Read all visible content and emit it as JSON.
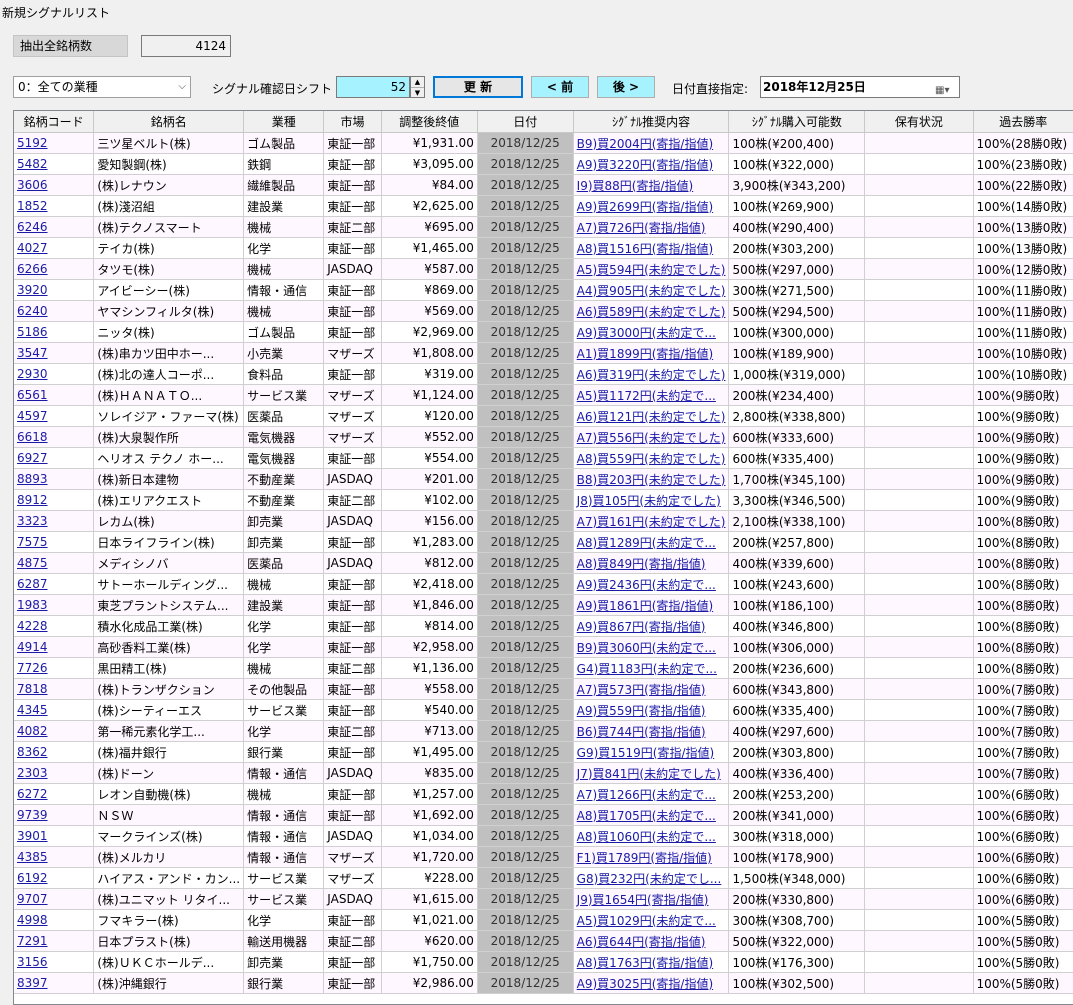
{
  "window": {
    "title": "新規シグナルリスト"
  },
  "summary": {
    "label": "抽出全銘柄数",
    "value": "4124"
  },
  "controls": {
    "industry_selected": "0：全ての業種",
    "shift_label": "シグナル確認日シフト",
    "shift_value": "52",
    "update_label": "更 新",
    "prev_label": "< 前",
    "next_label": "後 >",
    "date_label": "日付直接指定:",
    "date_value": "2018年12月25日"
  },
  "table": {
    "headers": [
      "銘柄コード",
      "銘柄名",
      "業種",
      "市場",
      "調整後終値",
      "日付",
      "ｼｸﾞﾅﾙ推奨内容",
      "ｼｸﾞﾅﾙ購入可能数",
      "保有状況",
      "過去勝率"
    ],
    "rows": [
      [
        "5192",
        "三ツ星ベルト(株)",
        "ゴム製品",
        "東証一部",
        "¥1,931.00",
        "2018/12/25",
        "B9)買2004円(寄指/指値)",
        "100株(¥200,400)",
        "",
        "100%(28勝0敗)"
      ],
      [
        "5482",
        "愛知製鋼(株)",
        "鉄鋼",
        "東証一部",
        "¥3,095.00",
        "2018/12/25",
        "A9)買3220円(寄指/指値)",
        "100株(¥322,000)",
        "",
        "100%(23勝0敗)"
      ],
      [
        "3606",
        "(株)レナウン",
        "繊維製品",
        "東証一部",
        "¥84.00",
        "2018/12/25",
        "I9)買88円(寄指/指値)",
        "3,900株(¥343,200)",
        "",
        "100%(22勝0敗)"
      ],
      [
        "1852",
        "(株)淺沼組",
        "建設業",
        "東証一部",
        "¥2,625.00",
        "2018/12/25",
        "A9)買2699円(寄指/指値)",
        "100株(¥269,900)",
        "",
        "100%(14勝0敗)"
      ],
      [
        "6246",
        "(株)テクノスマート",
        "機械",
        "東証二部",
        "¥695.00",
        "2018/12/25",
        "A7)買726円(寄指/指値)",
        "400株(¥290,400)",
        "",
        "100%(13勝0敗)"
      ],
      [
        "4027",
        "テイカ(株)",
        "化学",
        "東証一部",
        "¥1,465.00",
        "2018/12/25",
        "A8)買1516円(寄指/指値)",
        "200株(¥303,200)",
        "",
        "100%(13勝0敗)"
      ],
      [
        "6266",
        "タツモ(株)",
        "機械",
        "JASDAQ",
        "¥587.00",
        "2018/12/25",
        "A5)買594円(未約定でした)",
        "500株(¥297,000)",
        "",
        "100%(12勝0敗)"
      ],
      [
        "3920",
        "アイビーシー(株)",
        "情報・通信",
        "東証一部",
        "¥869.00",
        "2018/12/25",
        "A4)買905円(未約定でした)",
        "300株(¥271,500)",
        "",
        "100%(11勝0敗)"
      ],
      [
        "6240",
        "ヤマシンフィルタ(株)",
        "機械",
        "東証一部",
        "¥569.00",
        "2018/12/25",
        "A6)買589円(未約定でした)",
        "500株(¥294,500)",
        "",
        "100%(11勝0敗)"
      ],
      [
        "5186",
        "ニッタ(株)",
        "ゴム製品",
        "東証一部",
        "¥2,969.00",
        "2018/12/25",
        "A9)買3000円(未約定で...",
        "100株(¥300,000)",
        "",
        "100%(11勝0敗)"
      ],
      [
        "3547",
        "(株)串カツ田中ホー...",
        "小売業",
        "マザーズ",
        "¥1,808.00",
        "2018/12/25",
        "A1)買1899円(寄指/指値)",
        "100株(¥189,900)",
        "",
        "100%(10勝0敗)"
      ],
      [
        "2930",
        "(株)北の達人コーポ...",
        "食料品",
        "東証一部",
        "¥319.00",
        "2018/12/25",
        "A6)買319円(未約定でした)",
        "1,000株(¥319,000)",
        "",
        "100%(10勝0敗)"
      ],
      [
        "6561",
        "(株)ＨＡＮＡＴＯ...",
        "サービス業",
        "マザーズ",
        "¥1,124.00",
        "2018/12/25",
        "A5)買1172円(未約定で...",
        "200株(¥234,400)",
        "",
        "100%(9勝0敗)"
      ],
      [
        "4597",
        "ソレイジア・ファーマ(株)",
        "医薬品",
        "マザーズ",
        "¥120.00",
        "2018/12/25",
        "A6)買121円(未約定でした)",
        "2,800株(¥338,800)",
        "",
        "100%(9勝0敗)"
      ],
      [
        "6618",
        "(株)大泉製作所",
        "電気機器",
        "マザーズ",
        "¥552.00",
        "2018/12/25",
        "A7)買556円(未約定でした)",
        "600株(¥333,600)",
        "",
        "100%(9勝0敗)"
      ],
      [
        "6927",
        "ヘリオス テクノ ホー...",
        "電気機器",
        "東証一部",
        "¥554.00",
        "2018/12/25",
        "A8)買559円(未約定でした)",
        "600株(¥335,400)",
        "",
        "100%(9勝0敗)"
      ],
      [
        "8893",
        "(株)新日本建物",
        "不動産業",
        "JASDAQ",
        "¥201.00",
        "2018/12/25",
        "B8)買203円(未約定でした)",
        "1,700株(¥345,100)",
        "",
        "100%(9勝0敗)"
      ],
      [
        "8912",
        "(株)エリアクエスト",
        "不動産業",
        "東証二部",
        "¥102.00",
        "2018/12/25",
        "J8)買105円(未約定でした)",
        "3,300株(¥346,500)",
        "",
        "100%(9勝0敗)"
      ],
      [
        "3323",
        "レカム(株)",
        "卸売業",
        "JASDAQ",
        "¥156.00",
        "2018/12/25",
        "A7)買161円(未約定でした)",
        "2,100株(¥338,100)",
        "",
        "100%(8勝0敗)"
      ],
      [
        "7575",
        "日本ライフライン(株)",
        "卸売業",
        "東証一部",
        "¥1,283.00",
        "2018/12/25",
        "A8)買1289円(未約定で...",
        "200株(¥257,800)",
        "",
        "100%(8勝0敗)"
      ],
      [
        "4875",
        "メディシノバ",
        "医薬品",
        "JASDAQ",
        "¥812.00",
        "2018/12/25",
        "A8)買849円(寄指/指値)",
        "400株(¥339,600)",
        "",
        "100%(8勝0敗)"
      ],
      [
        "6287",
        "サトーホールディング...",
        "機械",
        "東証一部",
        "¥2,418.00",
        "2018/12/25",
        "A9)買2436円(未約定で...",
        "100株(¥243,600)",
        "",
        "100%(8勝0敗)"
      ],
      [
        "1983",
        "東芝プラントシステム...",
        "建設業",
        "東証一部",
        "¥1,846.00",
        "2018/12/25",
        "A9)買1861円(寄指/指値)",
        "100株(¥186,100)",
        "",
        "100%(8勝0敗)"
      ],
      [
        "4228",
        "積水化成品工業(株)",
        "化学",
        "東証一部",
        "¥814.00",
        "2018/12/25",
        "A9)買867円(寄指/指値)",
        "400株(¥346,800)",
        "",
        "100%(8勝0敗)"
      ],
      [
        "4914",
        "高砂香料工業(株)",
        "化学",
        "東証一部",
        "¥2,958.00",
        "2018/12/25",
        "B9)買3060円(未約定で...",
        "100株(¥306,000)",
        "",
        "100%(8勝0敗)"
      ],
      [
        "7726",
        "黒田精工(株)",
        "機械",
        "東証二部",
        "¥1,136.00",
        "2018/12/25",
        "G4)買1183円(未約定で...",
        "200株(¥236,600)",
        "",
        "100%(8勝0敗)"
      ],
      [
        "7818",
        "(株)トランザクション",
        "その他製品",
        "東証一部",
        "¥558.00",
        "2018/12/25",
        "A7)買573円(寄指/指値)",
        "600株(¥343,800)",
        "",
        "100%(7勝0敗)"
      ],
      [
        "4345",
        "(株)シーティーエス",
        "サービス業",
        "東証一部",
        "¥540.00",
        "2018/12/25",
        "A9)買559円(寄指/指値)",
        "600株(¥335,400)",
        "",
        "100%(7勝0敗)"
      ],
      [
        "4082",
        "第一稀元素化学工...",
        "化学",
        "東証二部",
        "¥713.00",
        "2018/12/25",
        "B6)買744円(寄指/指値)",
        "400株(¥297,600)",
        "",
        "100%(7勝0敗)"
      ],
      [
        "8362",
        "(株)福井銀行",
        "銀行業",
        "東証一部",
        "¥1,495.00",
        "2018/12/25",
        "G9)買1519円(寄指/指値)",
        "200株(¥303,800)",
        "",
        "100%(7勝0敗)"
      ],
      [
        "2303",
        "(株)ドーン",
        "情報・通信",
        "JASDAQ",
        "¥835.00",
        "2018/12/25",
        "J7)買841円(未約定でした)",
        "400株(¥336,400)",
        "",
        "100%(7勝0敗)"
      ],
      [
        "6272",
        "レオン自動機(株)",
        "機械",
        "東証一部",
        "¥1,257.00",
        "2018/12/25",
        "A7)買1266円(未約定で...",
        "200株(¥253,200)",
        "",
        "100%(6勝0敗)"
      ],
      [
        "9739",
        "ＮＳＷ",
        "情報・通信",
        "東証一部",
        "¥1,692.00",
        "2018/12/25",
        "A8)買1705円(未約定で...",
        "200株(¥341,000)",
        "",
        "100%(6勝0敗)"
      ],
      [
        "3901",
        "マークラインズ(株)",
        "情報・通信",
        "JASDAQ",
        "¥1,034.00",
        "2018/12/25",
        "A8)買1060円(未約定で...",
        "300株(¥318,000)",
        "",
        "100%(6勝0敗)"
      ],
      [
        "4385",
        "(株)メルカリ",
        "情報・通信",
        "マザーズ",
        "¥1,720.00",
        "2018/12/25",
        "F1)買1789円(寄指/指値)",
        "100株(¥178,900)",
        "",
        "100%(6勝0敗)"
      ],
      [
        "6192",
        "ハイアス・アンド・カン...",
        "サービス業",
        "マザーズ",
        "¥228.00",
        "2018/12/25",
        "G8)買232円(未約定でし...",
        "1,500株(¥348,000)",
        "",
        "100%(6勝0敗)"
      ],
      [
        "9707",
        "(株)ユニマット リタイ...",
        "サービス業",
        "JASDAQ",
        "¥1,615.00",
        "2018/12/25",
        "J9)買1654円(寄指/指値)",
        "200株(¥330,800)",
        "",
        "100%(6勝0敗)"
      ],
      [
        "4998",
        "フマキラー(株)",
        "化学",
        "東証一部",
        "¥1,021.00",
        "2018/12/25",
        "A5)買1029円(未約定で...",
        "300株(¥308,700)",
        "",
        "100%(5勝0敗)"
      ],
      [
        "7291",
        "日本プラスト(株)",
        "輸送用機器",
        "東証二部",
        "¥620.00",
        "2018/12/25",
        "A6)買644円(寄指/指値)",
        "500株(¥322,000)",
        "",
        "100%(5勝0敗)"
      ],
      [
        "3156",
        "(株)ＵＫＣホールデ...",
        "卸売業",
        "東証一部",
        "¥1,750.00",
        "2018/12/25",
        "A8)買1763円(寄指/指値)",
        "100株(¥176,300)",
        "",
        "100%(5勝0敗)"
      ],
      [
        "8397",
        "(株)沖縄銀行",
        "銀行業",
        "東証一部",
        "¥2,986.00",
        "2018/12/25",
        "A9)買3025円(寄指/指値)",
        "100株(¥302,500)",
        "",
        "100%(5勝0敗)"
      ]
    ]
  }
}
